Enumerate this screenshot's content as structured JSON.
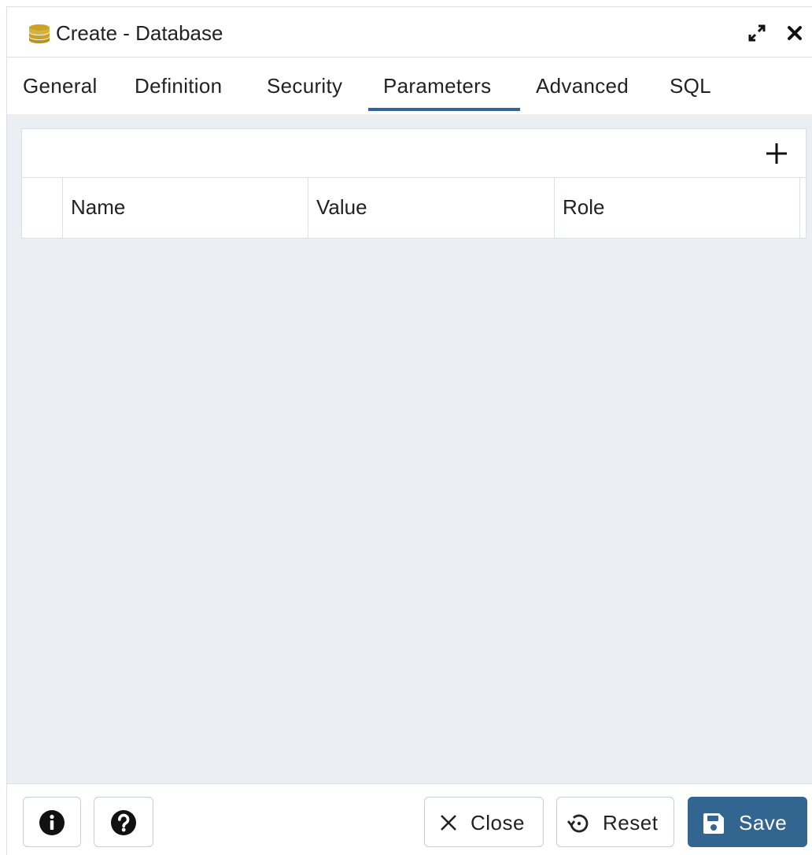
{
  "dialog": {
    "title": "Create - Database",
    "icon": "database-icon",
    "window_controls": [
      "maximize-icon",
      "close-icon"
    ]
  },
  "tabs": [
    {
      "label": "General",
      "active": false
    },
    {
      "label": "Definition",
      "active": false
    },
    {
      "label": "Security",
      "active": false
    },
    {
      "label": "Parameters",
      "active": true
    },
    {
      "label": "Advanced",
      "active": false
    },
    {
      "label": "SQL",
      "active": false
    }
  ],
  "parameters_grid": {
    "add_icon": "plus-icon",
    "columns": [
      "Name",
      "Value",
      "Role"
    ],
    "rows": []
  },
  "footer": {
    "info_icon": "info-icon",
    "help_icon": "help-icon",
    "close_label": "Close",
    "reset_label": "Reset",
    "save_label": "Save"
  },
  "colors": {
    "accent": "#326690",
    "content_background": "#ebeef3",
    "database_icon": "#c9a227"
  }
}
